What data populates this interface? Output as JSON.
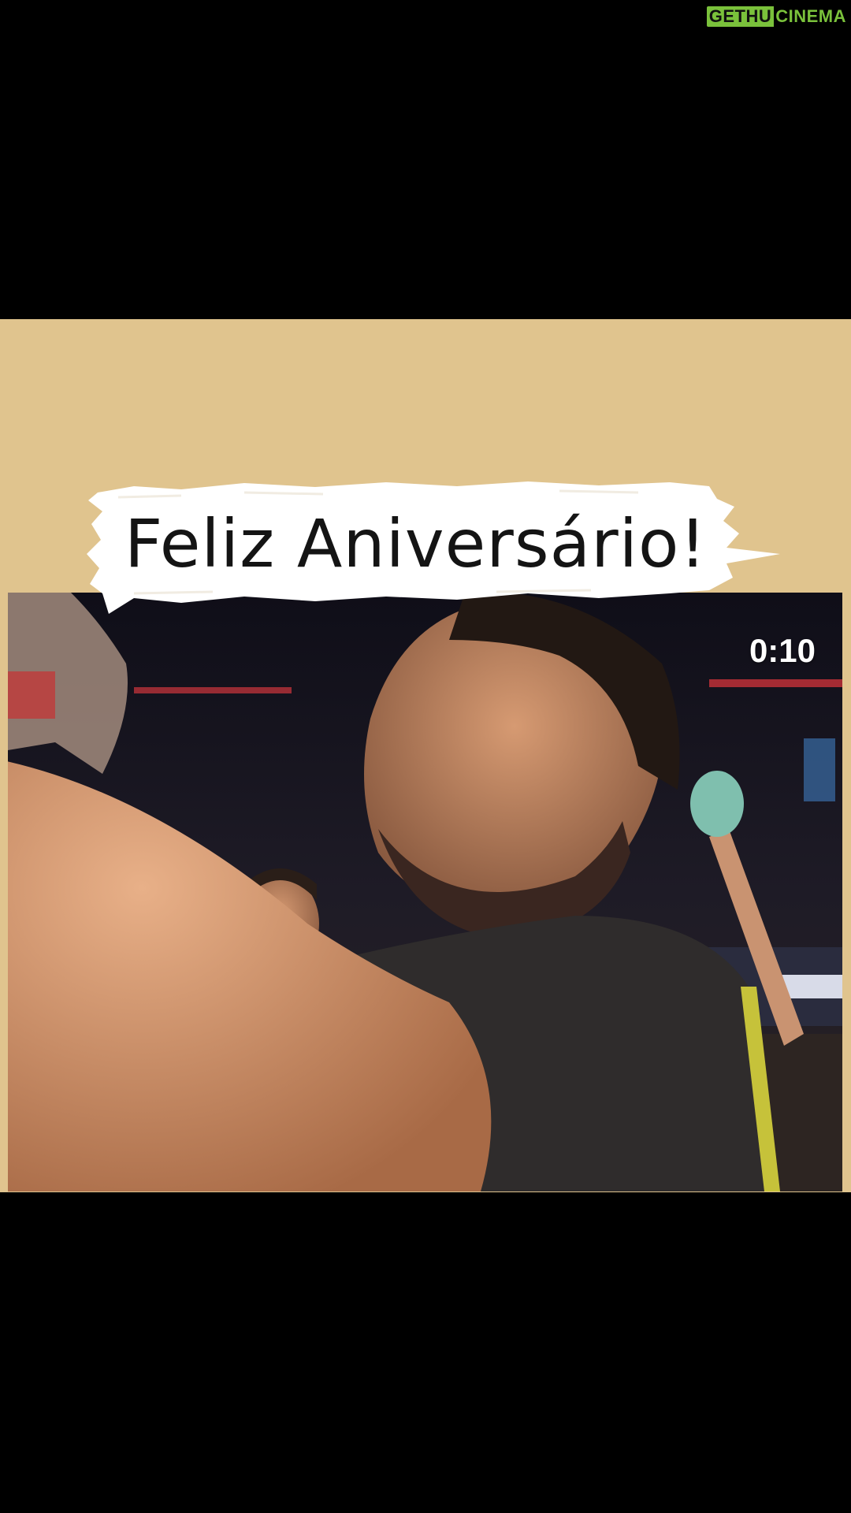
{
  "watermark": {
    "part1": "GETHU",
    "part2": "CINEMA"
  },
  "banner": {
    "text": "Feliz Aniversário!"
  },
  "video": {
    "elapsed": "0:10"
  },
  "colors": {
    "background": "#000000",
    "card": "#e0c48e",
    "banner_brush": "#ffffff",
    "watermark_green": "#7ac13b"
  }
}
